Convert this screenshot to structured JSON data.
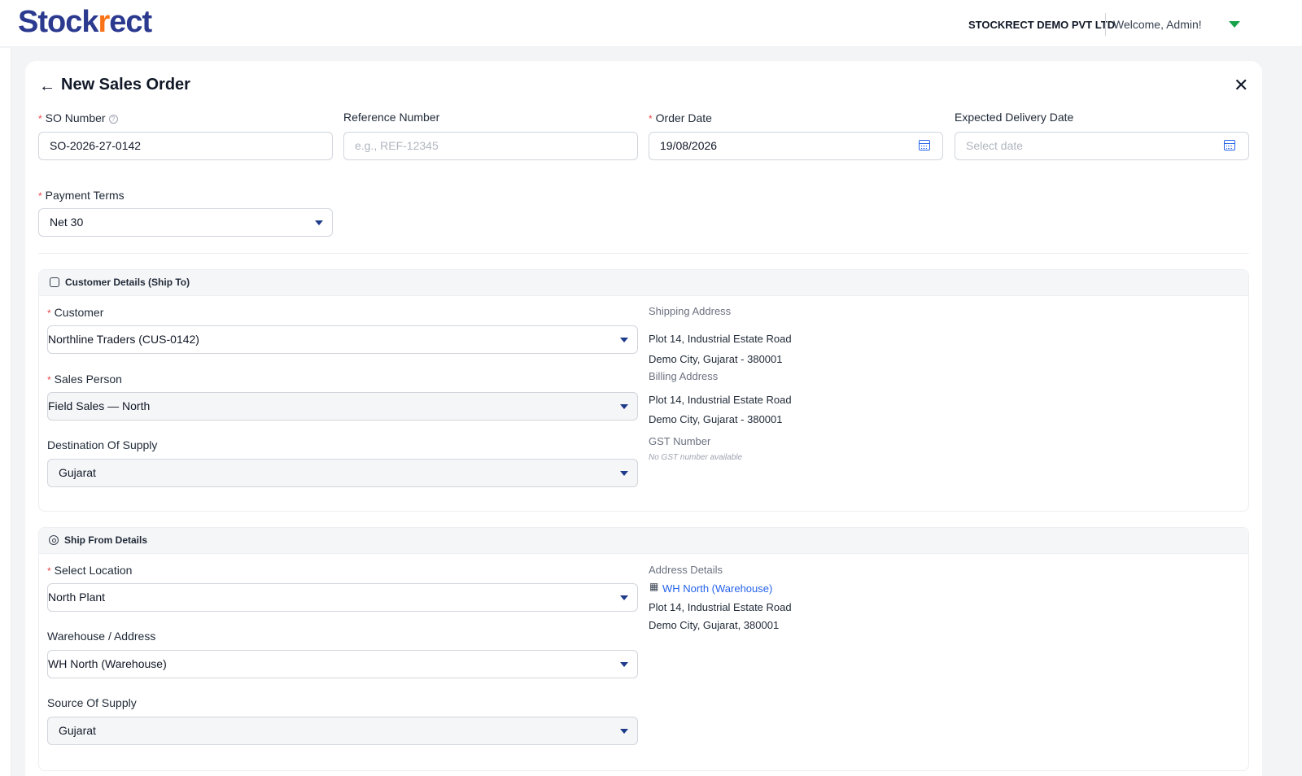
{
  "brand": {
    "logo_text_a": "Stock",
    "logo_text_b": "rect",
    "accent": "#f97316",
    "primary": "#2b3a8f"
  },
  "header": {
    "company": "STOCKRECT DEMO PVT LTD",
    "welcome": "Welcome, Admin!"
  },
  "page": {
    "title": "New Sales Order"
  },
  "form": {
    "so_number_label": "SO Number",
    "so_number_value": "SO-2026-27-0142",
    "reference_label": "Reference Number",
    "reference_placeholder": "e.g., REF-12345",
    "order_date_label": "Order Date",
    "order_date_value": "19/08/2026",
    "expected_delivery_label": "Expected Delivery Date",
    "expected_delivery_placeholder": "Select date",
    "payment_terms_label": "Payment Terms",
    "payment_terms_value": "Net 30"
  },
  "customer_section": {
    "title": "Customer Details (Ship To)",
    "customer_label": "Customer",
    "customer_value": "Northline Traders (CUS-0142)",
    "sales_person_label": "Sales Person",
    "sales_person_value": "Field Sales — North",
    "destination_label": "Destination Of Supply",
    "destination_value": "Gujarat",
    "shipping_address_label": "Shipping Address",
    "shipping_line1": "Plot 14, Industrial Estate Road",
    "shipping_line2": "Demo City, Gujarat - 380001",
    "billing_address_label": "Billing Address",
    "billing_line1": "Plot 14, Industrial Estate Road",
    "billing_line2": "Demo City, Gujarat - 380001",
    "gst_label": "GST Number",
    "gst_note": "No GST number available"
  },
  "ship_from_section": {
    "title": "Ship From Details",
    "location_label": "Select Location",
    "location_value": "North Plant",
    "warehouse_label": "Warehouse / Address",
    "warehouse_value": "WH North (Warehouse)",
    "source_label": "Source Of Supply",
    "source_value": "Gujarat",
    "address_details_label": "Address Details",
    "warehouse_link": "WH North (Warehouse)",
    "address_line1": "Plot 14, Industrial Estate Road",
    "address_line2": "Demo City, Gujarat, 380001"
  }
}
